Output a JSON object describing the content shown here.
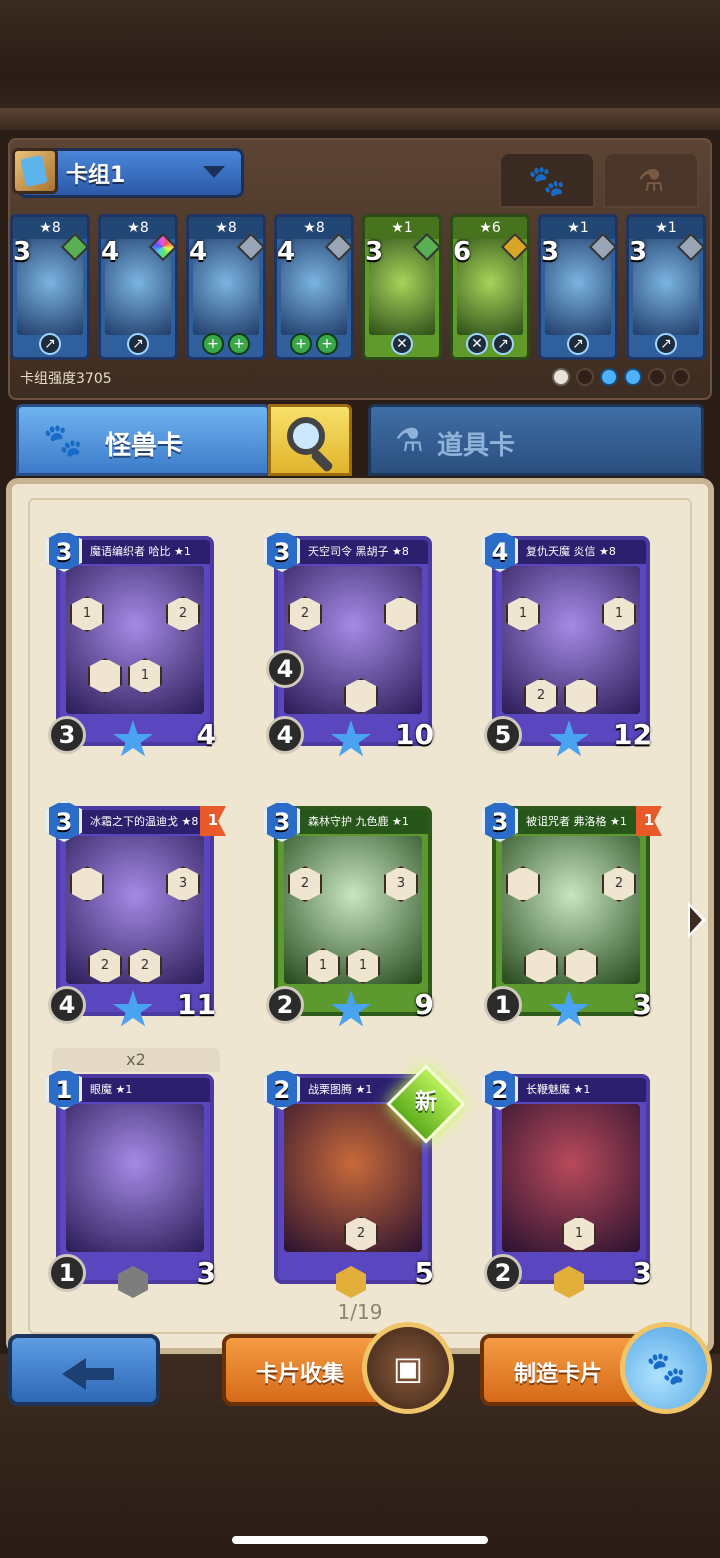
{
  "deck": {
    "name": "卡组1",
    "strength": "卡组强度3705"
  },
  "deck_cards": [
    {
      "cost": "3",
      "stars": "★8",
      "gem": "green",
      "badges": [
        "↗"
      ]
    },
    {
      "cost": "4",
      "stars": "★8",
      "gem": "color",
      "badges": [
        "↗"
      ]
    },
    {
      "cost": "4",
      "stars": "★8",
      "gem": "gray",
      "badges": [
        "+",
        "+"
      ]
    },
    {
      "cost": "4",
      "stars": "★8",
      "gem": "gray",
      "badges": [
        "+",
        "+"
      ]
    },
    {
      "cost": "3",
      "stars": "★1",
      "gem": "green",
      "badges": [
        "✕"
      ]
    },
    {
      "cost": "6",
      "stars": "★6",
      "gem": "gold",
      "badges": [
        "✕",
        "↗"
      ]
    },
    {
      "cost": "3",
      "stars": "★1",
      "gem": "gray",
      "badges": [
        "↗"
      ]
    },
    {
      "cost": "3",
      "stars": "★1",
      "gem": "gray",
      "badges": [
        "↗"
      ]
    }
  ],
  "tabs": {
    "monster": "怪兽卡",
    "items": "道具卡"
  },
  "cards": [
    {
      "name": "魔语编织者 哈比 ★1",
      "cost": "3",
      "atk": "3",
      "hp": "4",
      "abilities": [
        "1",
        "2",
        "",
        "1"
      ]
    },
    {
      "name": "天空司令 黑胡子 ★8",
      "cost": "3",
      "atk": "4",
      "hp": "10",
      "extra": "4",
      "abilities": [
        "2",
        "",
        ""
      ]
    },
    {
      "name": "复仇天魔 炎信 ★8",
      "cost": "4",
      "atk": "5",
      "hp": "12",
      "abilities": [
        "1",
        "1",
        "2",
        ""
      ]
    },
    {
      "name": "冰霜之下的温迪戈 ★8",
      "cost": "3",
      "atk": "4",
      "hp": "11",
      "flag": "1",
      "abilities": [
        "",
        "3",
        "2",
        "2"
      ]
    },
    {
      "name": "森林守护 九色鹿 ★1",
      "cost": "3",
      "atk": "2",
      "hp": "9",
      "abilities": [
        "2",
        "3",
        "1",
        "1"
      ]
    },
    {
      "name": "被诅咒者 弗洛格 ★1",
      "cost": "3",
      "atk": "1",
      "hp": "3",
      "flag": "1",
      "abilities": [
        "",
        "2",
        "",
        ""
      ]
    },
    {
      "name": "眼魔 ★1",
      "cost": "1",
      "atk": "1",
      "hp": "3",
      "dup": "x2",
      "abilities": []
    },
    {
      "name": "战栗图腾 ★1",
      "cost": "2",
      "atk": "",
      "hp": "5",
      "new": "新",
      "abilities": [
        "2"
      ]
    },
    {
      "name": "长鞭魅魔 ★1",
      "cost": "2",
      "atk": "2",
      "hp": "3",
      "abilities": [
        "1"
      ]
    }
  ],
  "pagination": "1/19",
  "buttons": {
    "collect": "卡片收集",
    "craft": "制造卡片"
  },
  "colors": {
    "blue_accent": "#3d7bc9",
    "orange_button": "#e07b24",
    "board_bg": "#efe6d2"
  }
}
